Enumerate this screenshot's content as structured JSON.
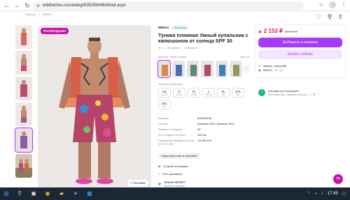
{
  "browser": {
    "url": "wildberries.ru/catalog/828293448/detail.aspx",
    "back": "←",
    "forward": "→",
    "reload": "↻"
  },
  "breadcrumb": [
    "Главная",
    "MINGO"
  ],
  "main": {
    "sale_badge": "РАСПРОДАЖА",
    "similar_btn": "Похожие"
  },
  "product": {
    "brand": "MINGO",
    "original_badge": "Оригинал",
    "title": "Туника пляжная Умный купальник с капюшоном от солнца SPF 30",
    "rating": "5",
    "reviews": "40 оценок",
    "questions": "19 вопрос",
    "color_label": "желтый, темно-синий",
    "color_all": "Все 16",
    "size_label": "Таблица размеров",
    "sizes": [
      {
        "s": "XS",
        "r": "40-42"
      },
      {
        "s": "S",
        "r": "44-46"
      },
      {
        "s": "M",
        "r": "48-50"
      },
      {
        "s": "L",
        "r": "50-54"
      },
      {
        "s": "XL",
        "r": "56"
      },
      {
        "s": "XXL",
        "r": "58"
      },
      {
        "s": "3XL",
        "r": "60"
      }
    ],
    "specs": [
      {
        "k": "Артикул",
        "v": "828293448"
      },
      {
        "k": "Состав",
        "v": "polyester 82%; Elastane 18%"
      },
      {
        "k": "Размер на модели",
        "v": "56"
      },
      {
        "k": "Рост модели на фото",
        "v": "180 см"
      },
      {
        "k": "Параметры модели на фото (ОГ-ОТ-ОБ)",
        "v": "110-80-110"
      }
    ],
    "char_btn": "Характеристики и описание",
    "return_text": "14 дней на возврат",
    "fitting_text": "Есть примерка"
  },
  "buybox": {
    "price": "2 153 ₽",
    "old_price": "10 856 ₽",
    "cart_btn": "Добавить в корзину",
    "buy_btn": "Купить сейчас",
    "delivery": "Завтра, склад WB",
    "seller": "MINGO",
    "seller_rating": "4,9"
  },
  "parts": {
    "title": "Частями на 8 платежей",
    "sub": "Без переплат, первый платеж — 0 ₽"
  },
  "bottom": {
    "name": "Туники MINGO",
    "sub": "Бизнесе Архива"
  },
  "taskbar": {
    "time": "17:45"
  },
  "colors": {
    "accent": "#a73afd",
    "price": "#f91155",
    "sale": "#cb11ab"
  }
}
